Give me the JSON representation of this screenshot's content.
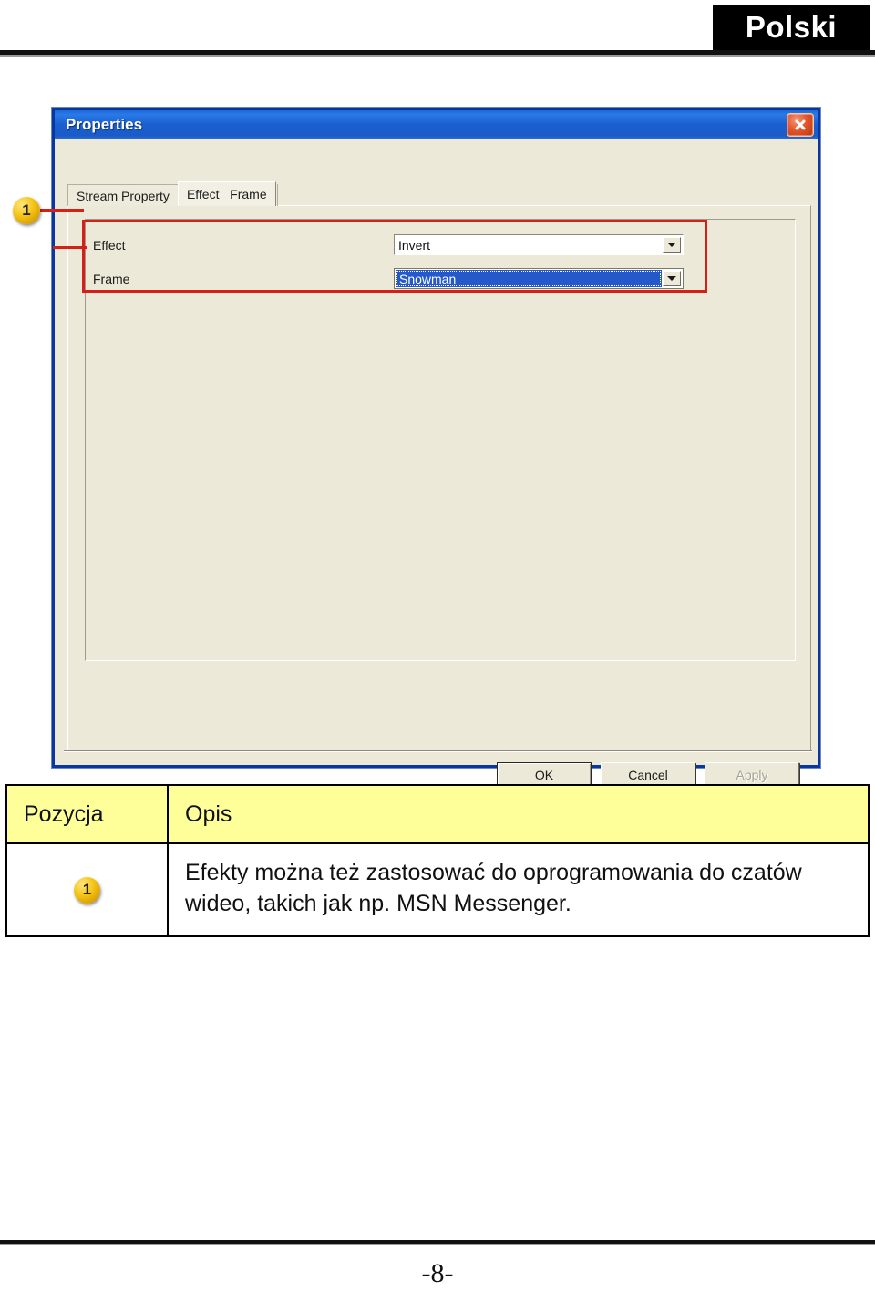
{
  "page": {
    "language_badge": "Polski",
    "page_number": "-8-"
  },
  "dialog": {
    "title": "Properties",
    "close_icon": "close-icon",
    "tabs": [
      {
        "label": "Stream Property",
        "active": false
      },
      {
        "label": "Effect _Frame",
        "active": true
      }
    ],
    "fields": [
      {
        "label": "Effect",
        "value": "Invert",
        "focused": false
      },
      {
        "label": "Frame",
        "value": "Snowman",
        "focused": true
      }
    ],
    "buttons": [
      {
        "label": "OK",
        "state": "default"
      },
      {
        "label": "Cancel",
        "state": "normal"
      },
      {
        "label": "Apply",
        "state": "disabled"
      }
    ]
  },
  "callout": {
    "number": "1"
  },
  "legend": {
    "headers": [
      "Pozycja",
      "Opis"
    ],
    "rows": [
      {
        "position": "1",
        "description": "Efekty można też zastosować do oprogramowania do czatów wideo, takich jak np. MSN Messenger."
      }
    ]
  },
  "colors": {
    "highlight_red": "#d61f16",
    "titlebar_blue": "#1b5fd0",
    "header_yellow": "#ffff99",
    "badge_gold": "#f5c518",
    "selection_blue": "#2558c8"
  }
}
